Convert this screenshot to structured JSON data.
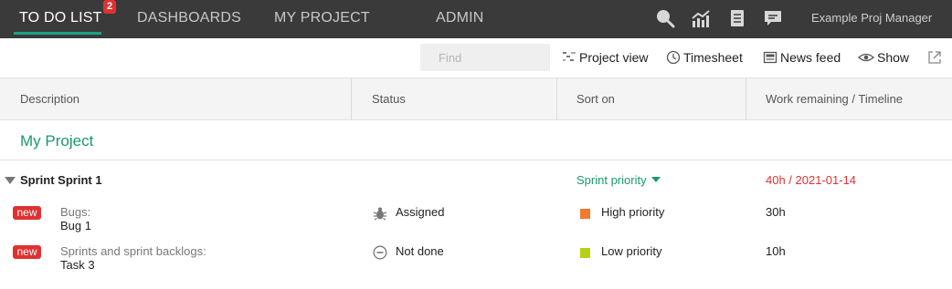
{
  "nav": {
    "tabs": [
      {
        "label": "TO DO LIST",
        "active": true
      },
      {
        "label": "DASHBOARDS",
        "active": false
      },
      {
        "label": "MY PROJECT",
        "active": false
      },
      {
        "label": "ADMIN",
        "active": false
      }
    ],
    "todo_badge": "2",
    "icons": [
      "search-icon",
      "analytics-icon",
      "document-icon",
      "chat-icon"
    ],
    "user": "Example Proj Manager",
    "accent_color": "#1aa383",
    "badge_color": "#e03131"
  },
  "toolbar": {
    "find_placeholder": "Find",
    "project_view": "Project view",
    "timesheet": "Timesheet",
    "news_feed": "News feed",
    "show": "Show"
  },
  "columns": {
    "description": "Description",
    "status": "Status",
    "sort_on": "Sort on",
    "work": "Work remaining / Timeline"
  },
  "project": {
    "title": "My Project",
    "title_color": "#1a9a6c"
  },
  "sprint": {
    "name": "Sprint Sprint 1",
    "priority": "Sprint priority",
    "work": "40h / 2021-01-14"
  },
  "tasks": [
    {
      "badge": "new",
      "category": "Bugs:",
      "name": "Bug 1",
      "status_icon": "bug-icon",
      "status": "Assigned",
      "priority": "High priority",
      "priority_color": "#f07a30",
      "work": "30h"
    },
    {
      "badge": "new",
      "category": "Sprints and sprint backlogs:",
      "name": "Task 3",
      "status_icon": "not-done-icon",
      "status": "Not done",
      "priority": "Low priority",
      "priority_color": "#b8cf12",
      "work": "10h"
    }
  ]
}
